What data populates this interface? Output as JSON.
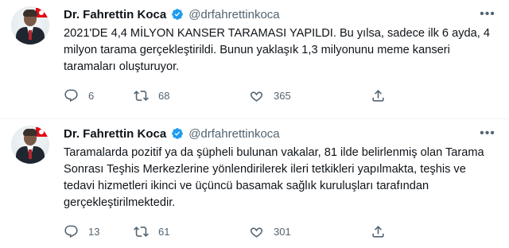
{
  "tweets": [
    {
      "author": {
        "name": "Dr. Fahrettin Koca",
        "handle": "@drfahrettinkoca"
      },
      "text": "2021'DE 4,4 MİLYON KANSER TARAMASI YAPILDI. Bu yılsa, sadece ilk 6 ayda, 4 milyon tarama gerçekleştirildi. Bunun yaklaşık 1,3 milyonunu meme kanseri taramaları oluşturuyor.",
      "stats": {
        "replies": "6",
        "retweets": "68",
        "likes": "365"
      }
    },
    {
      "author": {
        "name": "Dr. Fahrettin Koca",
        "handle": "@drfahrettinkoca"
      },
      "text": "Taramalarda pozitif ya da şüpheli bulunan vakalar, 81 ilde belirlenmiş olan Tarama Sonrası Teşhis Merkezlerine yönlendirilerek ileri tetkikleri yapılmakta, teşhis ve tedavi hizmetleri ikinci ve üçüncü basamak sağlık kuruluşları tarafından gerçekleştirilmektedir.",
      "stats": {
        "replies": "13",
        "retweets": "61",
        "likes": "301"
      }
    }
  ],
  "icons": {
    "verified": "verified-badge-icon",
    "more": "more-dots-icon",
    "reply": "reply-icon",
    "retweet": "retweet-icon",
    "like": "heart-icon",
    "share": "share-icon"
  },
  "colors": {
    "text": "#0f1419",
    "secondary": "#536471",
    "verified": "#1d9bf0",
    "divider": "#eff3f4"
  }
}
